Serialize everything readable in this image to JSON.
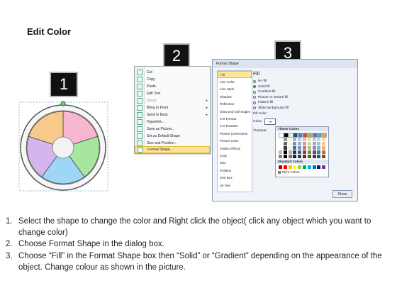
{
  "title": "Edit Color",
  "steps": {
    "one": "1",
    "two": "2",
    "three": "3"
  },
  "context_menu": {
    "items": [
      {
        "label": "Cut",
        "disabled": false,
        "arrow": false
      },
      {
        "label": "Copy",
        "disabled": false,
        "arrow": false
      },
      {
        "label": "Paste",
        "disabled": false,
        "arrow": false
      },
      {
        "label": "Edit Text",
        "disabled": false,
        "arrow": false
      },
      {
        "label": "Group",
        "disabled": true,
        "arrow": true
      },
      {
        "label": "Bring to Front",
        "disabled": false,
        "arrow": true
      },
      {
        "label": "Send to Back",
        "disabled": false,
        "arrow": true
      },
      {
        "label": "Hyperlink...",
        "disabled": false,
        "arrow": false
      },
      {
        "label": "Save as Picture...",
        "disabled": false,
        "arrow": false
      },
      {
        "label": "Set as Default Shape",
        "disabled": false,
        "arrow": false
      },
      {
        "label": "Size and Position...",
        "disabled": false,
        "arrow": false
      },
      {
        "label": "Format Shape...",
        "disabled": false,
        "arrow": false,
        "selected": true
      }
    ]
  },
  "dialog": {
    "title": "Format Shape",
    "categories": [
      "Fill",
      "Line Color",
      "Line Style",
      "Shadow",
      "Reflection",
      "Glow and Soft Edges",
      "3-D Format",
      "3-D Rotation",
      "Picture Corrections",
      "Picture Color",
      "Artistic Effects",
      "Crop",
      "Size",
      "Position",
      "Text Box",
      "Alt Text"
    ],
    "section_title": "Fill",
    "options": [
      "No fill",
      "Solid fill",
      "Gradient fill",
      "Picture or texture fill",
      "Pattern fill",
      "Slide background fill"
    ],
    "fill_color_label": "Fill Color",
    "color_label": "Color:",
    "transparency_label": "Transpar",
    "close_label": "Close"
  },
  "palette": {
    "theme_label": "Theme Colors",
    "standard_label": "Standard Colors",
    "more_label": "More Colors..."
  },
  "colors": {
    "pink": "#f7b6d2",
    "green": "#a8e6a0",
    "blue": "#9fd6f5",
    "purple": "#d6b4ee",
    "orange": "#f7c98b"
  },
  "instructions": [
    {
      "n": "1.",
      "text": "Select the shape to change the color and Right click the object( click any object which you want to change color)"
    },
    {
      "n": "2.",
      "text": "Choose Format Shape in the dialog box."
    },
    {
      "n": "3.",
      "text": "Choose “Fill” in the Format Shape box then “Solid” or “Gradient” depending on the appearance of the object. Change colour as shown in the picture."
    }
  ]
}
